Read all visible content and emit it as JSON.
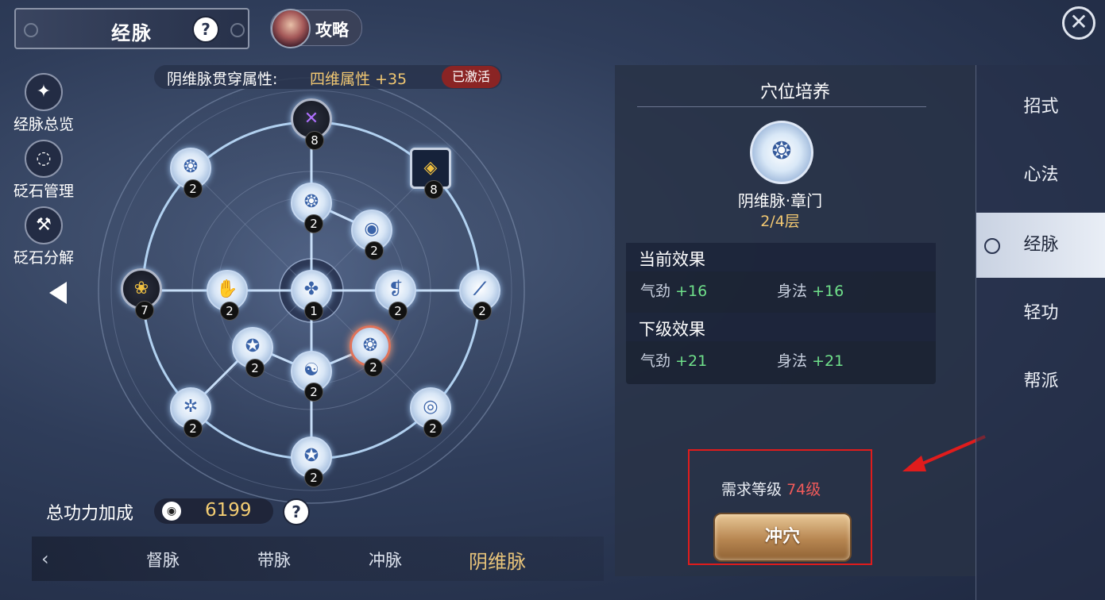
{
  "header": {
    "title": "经脉",
    "help": "?",
    "guide_label": "攻略",
    "close": "✕"
  },
  "left_menu": [
    {
      "label": "经脉总览",
      "icon": "constellation-icon"
    },
    {
      "label": "砭石管理",
      "icon": "circle-nodes-icon"
    },
    {
      "label": "砭石分解",
      "icon": "hammer-icon"
    }
  ],
  "banner": {
    "label": "阴维脉贯穿属性:",
    "bonus": "四维属性 +35",
    "status": "已激活"
  },
  "nodes": {
    "top_dark": "8",
    "top_right_square": "8",
    "left_dark": "7",
    "outer_tl": "2",
    "inner_top": "2",
    "inner_tr": "2",
    "inner_left": "2",
    "center": "1",
    "inner_right": "2",
    "outer_right": "2",
    "inner_bl": "2",
    "inner_bottom": "2",
    "selected": "2",
    "outer_bl": "2",
    "outer_br": "2",
    "bottom": "2"
  },
  "total": {
    "label": "总功力加成",
    "value": "6199",
    "help": "?"
  },
  "bottom_tabs": {
    "prev": "‹",
    "tab1": "督脉",
    "tab2": "带脉",
    "tab3": "冲脉",
    "tab4": "阴维脉"
  },
  "panel": {
    "title": "穴位培养",
    "node_name": "阴维脉·章门",
    "layer": "2/4层",
    "current": {
      "title": "当前效果",
      "stat1": "气劲",
      "val1": "+16",
      "stat2": "身法",
      "val2": "+16"
    },
    "next": {
      "title": "下级效果",
      "stat1": "气劲",
      "val1": "+21",
      "stat2": "身法",
      "val2": "+21"
    },
    "req_label": "需求等级",
    "req_level": "74级",
    "button": "冲穴"
  },
  "right_tabs": [
    "招式",
    "心法",
    "经脉",
    "轻功",
    "帮派"
  ],
  "active_right_tab": "经脉"
}
